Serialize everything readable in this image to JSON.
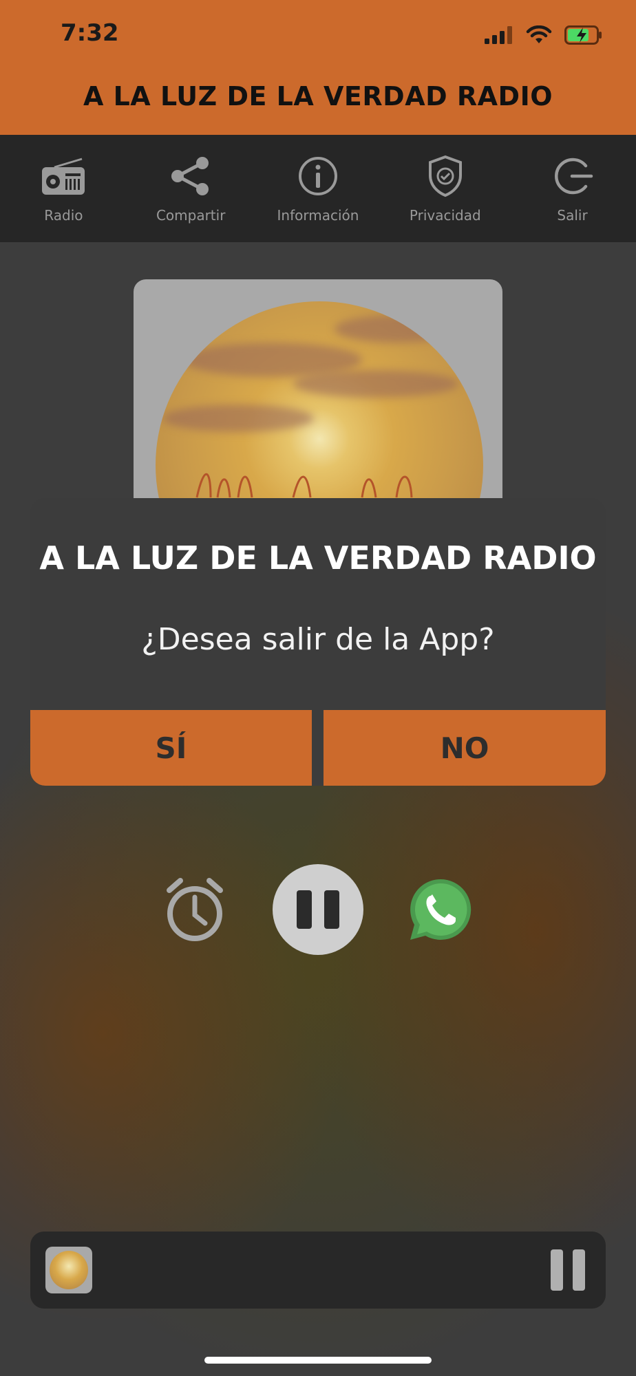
{
  "status_bar": {
    "time": "7:32"
  },
  "header": {
    "title": "A LA LUZ DE LA VERDAD RADIO"
  },
  "nav": {
    "items": [
      {
        "label": "Radio",
        "icon": "radio-icon"
      },
      {
        "label": "Compartir",
        "icon": "share-icon"
      },
      {
        "label": "Información",
        "icon": "info-icon"
      },
      {
        "label": "Privacidad",
        "icon": "shield-check-icon"
      },
      {
        "label": "Salir",
        "icon": "power-icon"
      }
    ]
  },
  "dialog": {
    "title": "A LA LUZ DE LA VERDAD RADIO",
    "message": "¿Desea salir de la App?",
    "yes_label": "SÍ",
    "no_label": "NO"
  },
  "controls": {
    "timer_icon": "alarm-clock-icon",
    "play_state": "playing",
    "whatsapp_icon": "whatsapp-icon"
  },
  "colors": {
    "accent": "#cc6a2c",
    "navbar": "#262626",
    "dialog_bg": "#3c3c3c"
  }
}
